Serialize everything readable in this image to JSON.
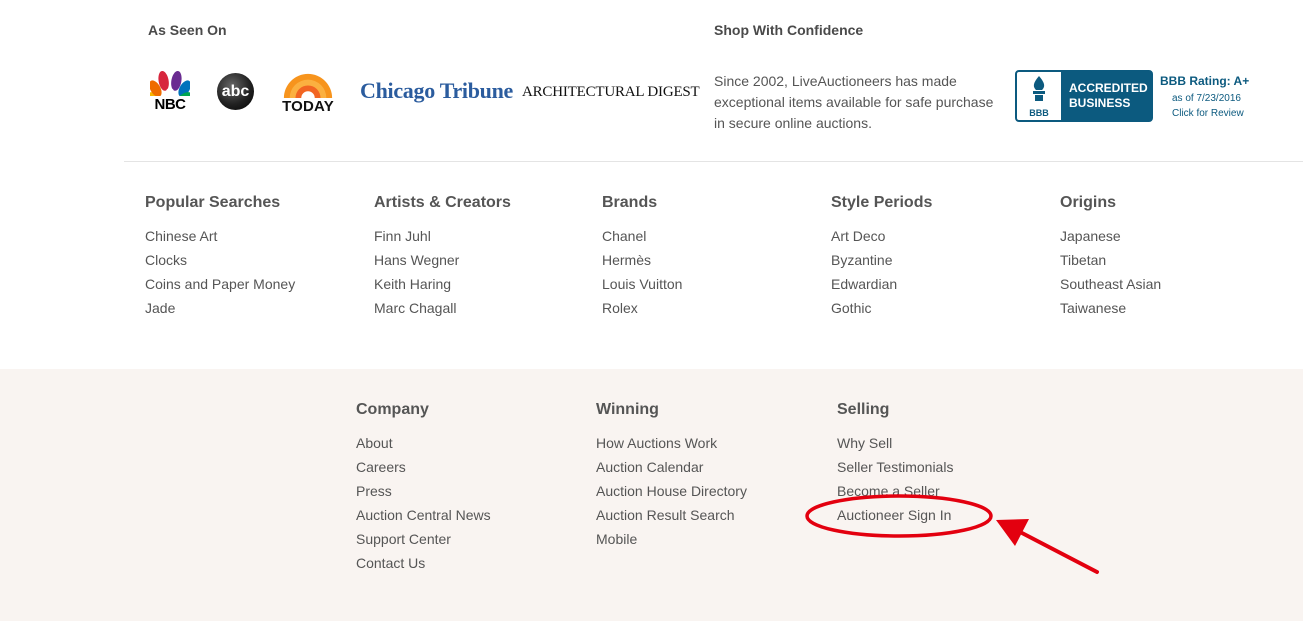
{
  "as_seen_on": {
    "title": "As Seen On",
    "logos": {
      "nbc": "NBC",
      "abc": "abc",
      "today": "TODAY",
      "tribune": "Chicago Tribune",
      "archdigest": "ARCHITECTURAL DIGEST"
    }
  },
  "confidence": {
    "title": "Shop With Confidence",
    "text": "Since 2002, LiveAuctioneers has made exceptional items available for safe purchase in secure online auctions.",
    "bbb": {
      "badge_line1": "ACCREDITED",
      "badge_line2": "BUSINESS",
      "badge_logo": "BBB",
      "rating": "BBB Rating: A+",
      "date": "as of 7/23/2016",
      "review": "Click for Review"
    }
  },
  "categories": [
    {
      "title": "Popular Searches",
      "links": [
        "Chinese Art",
        "Clocks",
        "Coins and Paper Money",
        "Jade"
      ]
    },
    {
      "title": "Artists & Creators",
      "links": [
        "Finn Juhl",
        "Hans Wegner",
        "Keith Haring",
        "Marc Chagall"
      ]
    },
    {
      "title": "Brands",
      "links": [
        "Chanel",
        "Hermès",
        "Louis Vuitton",
        "Rolex"
      ]
    },
    {
      "title": "Style Periods",
      "links": [
        "Art Deco",
        "Byzantine",
        "Edwardian",
        "Gothic"
      ]
    },
    {
      "title": "Origins",
      "links": [
        "Japanese",
        "Tibetan",
        "Southeast Asian",
        "Taiwanese"
      ]
    }
  ],
  "footer": [
    {
      "title": "Company",
      "links": [
        "About",
        "Careers",
        "Press",
        "Auction Central News",
        "Support Center",
        "Contact Us"
      ]
    },
    {
      "title": "Winning",
      "links": [
        "How Auctions Work",
        "Auction Calendar",
        "Auction House Directory",
        "Auction Result Search",
        "Mobile"
      ]
    },
    {
      "title": "Selling",
      "links": [
        "Why Sell",
        "Seller Testimonials",
        "Become a Seller",
        "Auctioneer Sign In"
      ]
    }
  ],
  "colors": {
    "accent_blue": "#0c5a7f",
    "footer_bg": "#f9f4f1",
    "annotation_red": "#e3000f",
    "text": "#555555"
  }
}
